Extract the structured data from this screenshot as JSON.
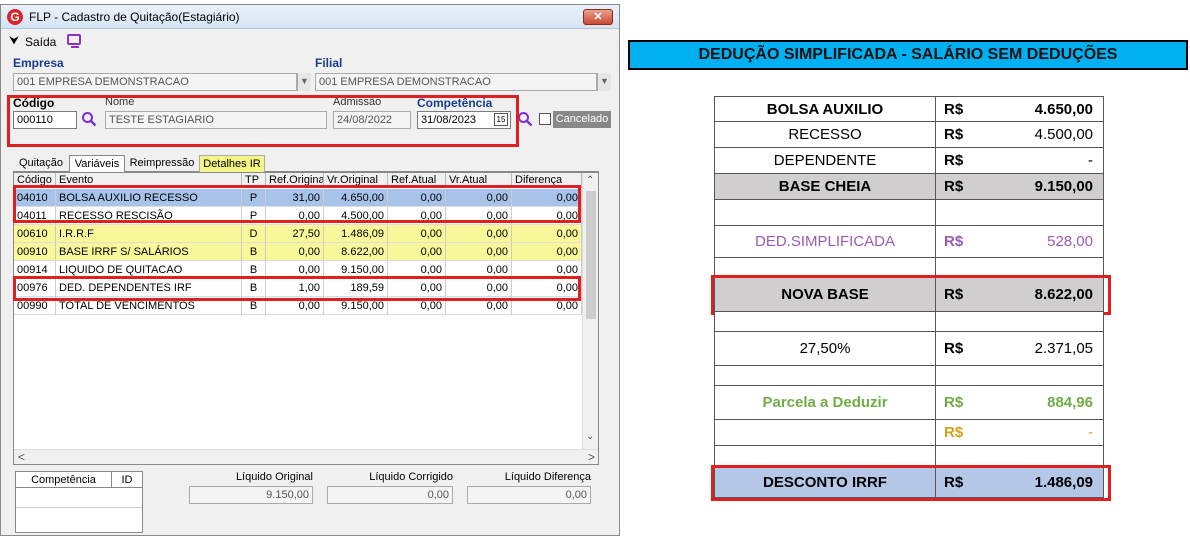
{
  "window": {
    "title": "FLP - Cadastro de Quitação(Estagiário)",
    "close_glyph": "✕",
    "app_icon": "G",
    "toolbar": {
      "exit_label": "Saída",
      "exit_icon": "arrow-down-icon",
      "monitor_icon": "monitor-icon"
    }
  },
  "form": {
    "empresa_label": "Empresa",
    "empresa_value": "001 EMPRESA DEMONSTRACAO",
    "filial_label": "Filial",
    "filial_value": "001 EMPRESA DEMONSTRACAO",
    "codigo_label": "Código",
    "codigo_value": "000110",
    "nome_label": "Nome",
    "nome_value": "TESTE ESTAGIARIO",
    "admissao_label": "Admissão",
    "admissao_value": "24/08/2022",
    "competencia_label": "Competência",
    "competencia_value": "31/08/2023",
    "calendar_glyph": "15",
    "cancelado_label": "Cancelado",
    "search_glyph": "🔍"
  },
  "tabs": [
    "Quitação",
    "Variáveis",
    "Reimpressão",
    "Detalhes IR"
  ],
  "grid": {
    "headers": [
      "Código",
      "Evento",
      "TP",
      "Ref.Original",
      "Vr.Original",
      "Ref.Atual",
      "Vr.Atual",
      "Diferença"
    ],
    "rows": [
      {
        "codigo": "04010",
        "evento": "BOLSA AUXILIO RECESSO",
        "tp": "P",
        "ref_original": "31,00",
        "vr_original": "4.650,00",
        "ref_atual": "0,00",
        "vr_atual": "0,00",
        "diferenca": "0,00",
        "style": "selected"
      },
      {
        "codigo": "04011",
        "evento": "RECESSO RESCISÃO",
        "tp": "P",
        "ref_original": "0,00",
        "vr_original": "4.500,00",
        "ref_atual": "0,00",
        "vr_atual": "0,00",
        "diferenca": "0,00",
        "style": "white"
      },
      {
        "codigo": "00610",
        "evento": "I.R.R.F",
        "tp": "D",
        "ref_original": "27,50",
        "vr_original": "1.486,09",
        "ref_atual": "0,00",
        "vr_atual": "0,00",
        "diferenca": "0,00",
        "style": "yellow"
      },
      {
        "codigo": "00910",
        "evento": "BASE IRRF S/ SALÁRIOS",
        "tp": "B",
        "ref_original": "0,00",
        "vr_original": "8.622,00",
        "ref_atual": "0,00",
        "vr_atual": "0,00",
        "diferenca": "0,00",
        "style": "yellow"
      },
      {
        "codigo": "00914",
        "evento": "LIQUIDO DE QUITACAO",
        "tp": "B",
        "ref_original": "0,00",
        "vr_original": "9.150,00",
        "ref_atual": "0,00",
        "vr_atual": "0,00",
        "diferenca": "0,00",
        "style": "white"
      },
      {
        "codigo": "00976",
        "evento": "DED. DEPENDENTES IRF",
        "tp": "B",
        "ref_original": "1,00",
        "vr_original": "189,59",
        "ref_atual": "0,00",
        "vr_atual": "0,00",
        "diferenca": "0,00",
        "style": "white"
      },
      {
        "codigo": "00990",
        "evento": "TOTAL DE VENCIMENTOS",
        "tp": "B",
        "ref_original": "0,00",
        "vr_original": "9.150,00",
        "ref_atual": "0,00",
        "vr_atual": "0,00",
        "diferenca": "0,00",
        "style": "white"
      }
    ]
  },
  "footer": {
    "competencia_col": "Competência",
    "id_col": "ID",
    "liquido_original_label": "Líquido Original",
    "liquido_original_value": "9.150,00",
    "liquido_corrigido_label": "Líquido Corrigido",
    "liquido_corrigido_value": "0,00",
    "liquido_diferenca_label": "Líquido Diferença",
    "liquido_diferenca_value": "0,00"
  },
  "sheet": {
    "banner": "DEDUÇÃO SIMPLIFICADA - SALÁRIO SEM DEDUÇÕES",
    "currency": "R$",
    "rows": [
      {
        "name": "BOLSA AUXILIO",
        "value": "4.650,00",
        "bold": true,
        "bg": "#ffffff",
        "color": "#000000"
      },
      {
        "name": "RECESSO",
        "value": "4.500,00",
        "bold": false,
        "bg": "#ffffff",
        "color": "#000000"
      },
      {
        "name": "DEPENDENTE",
        "value": "-",
        "bold": false,
        "bg": "#ffffff",
        "color": "#000000"
      },
      {
        "name": "BASE CHEIA",
        "value": "9.150,00",
        "bold": true,
        "bg": "#d0cece",
        "color": "#000000"
      },
      {
        "name": "",
        "value": "",
        "bold": false,
        "bg": "#ffffff",
        "color": "#000000",
        "empty": true
      },
      {
        "name": "DED.SIMPLIFICADA",
        "value": "528,00",
        "bold": false,
        "bg": "#ffffff",
        "color": "#9b59b6"
      },
      {
        "name": "",
        "value": "",
        "bold": false,
        "bg": "#ffffff",
        "color": "#000000",
        "empty": true
      },
      {
        "name": "NOVA BASE",
        "value": "8.622,00",
        "bold": true,
        "bg": "#d0cece",
        "color": "#000000"
      },
      {
        "name": "",
        "value": "",
        "bold": false,
        "bg": "#ffffff",
        "color": "#000000",
        "empty": true
      },
      {
        "name": "27,50%",
        "value": "2.371,05",
        "bold": false,
        "bg": "#ffffff",
        "color": "#000000"
      },
      {
        "name": "",
        "value": "",
        "bold": false,
        "bg": "#ffffff",
        "color": "#000000",
        "empty": true
      },
      {
        "name": "Parcela a Deduzir",
        "value": "884,96",
        "bold": true,
        "bg": "#ffffff",
        "color": "#70ad47"
      },
      {
        "name": "",
        "value": "-",
        "bold": false,
        "bg": "#ffffff",
        "color": "#d4a017",
        "cur_only": true
      },
      {
        "name": "",
        "value": "",
        "bold": false,
        "bg": "#ffffff",
        "color": "#000000",
        "empty": true
      },
      {
        "name": "DESCONTO IRRF",
        "value": "1.486,09",
        "bold": true,
        "bg": "#b4c7e7",
        "color": "#000000"
      }
    ]
  }
}
